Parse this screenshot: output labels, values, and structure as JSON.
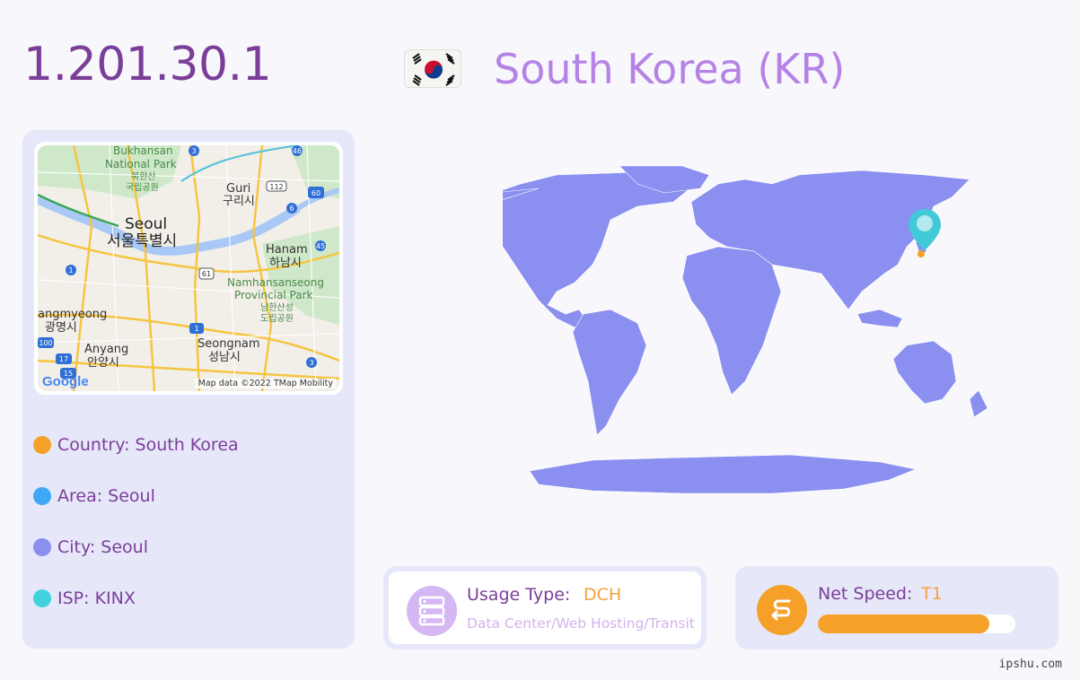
{
  "header": {
    "ip": "1.201.30.1",
    "country_title": "South Korea (KR)"
  },
  "map": {
    "attribution": "Map data ©2022 TMap Mobility",
    "google_logo": "Google",
    "labels": {
      "bukhansan": "Bukhansan",
      "national_park": "National Park",
      "bukhansan_kr1": "북한산",
      "bukhansan_kr2": "국립공원",
      "guri": "Guri",
      "guri_kr": "구리시",
      "seoul": "Seoul",
      "seoul_kr": "서울특별시",
      "hanam": "Hanam",
      "hanam_kr": "하남시",
      "namhansanseong": "Namhansanseong",
      "provincial_park": "Provincial Park",
      "namhan_kr1": "남한산성",
      "namhan_kr2": "도립공원",
      "gwangmyeong": "angmyeong",
      "gwangmyeong_kr": "광명시",
      "anyang": "Anyang",
      "anyang_kr": "안양시",
      "seongnam": "Seongnam",
      "seongnam_kr": "성남시"
    },
    "route_shields": {
      "r3a": "3",
      "r46": "46",
      "r112": "112",
      "r60": "60",
      "r6": "6",
      "r45": "45",
      "r1a": "1",
      "r61": "61",
      "r1b": "1",
      "r3b": "3",
      "r17": "17",
      "r100": "100",
      "r15": "15"
    }
  },
  "info": {
    "country": "Country: South Korea",
    "area": "Area: Seoul",
    "city": "City: Seoul",
    "isp": "ISP: KINX"
  },
  "colors": {
    "country_dot": "#f5a028",
    "area_dot": "#3ea8f5",
    "city_dot": "#8a8ff0",
    "isp_dot": "#3ed3dd",
    "world_land": "#8a8ff0",
    "marker": "#42c9d8"
  },
  "usage": {
    "label": "Usage Type:",
    "value": "DCH",
    "description": "Data Center/Web Hosting/Transit",
    "icon": "server-icon"
  },
  "speed": {
    "label": "Net Speed:",
    "value": "T1",
    "level_percent": 87,
    "icon": "speed-icon"
  },
  "site": "ipshu.com"
}
